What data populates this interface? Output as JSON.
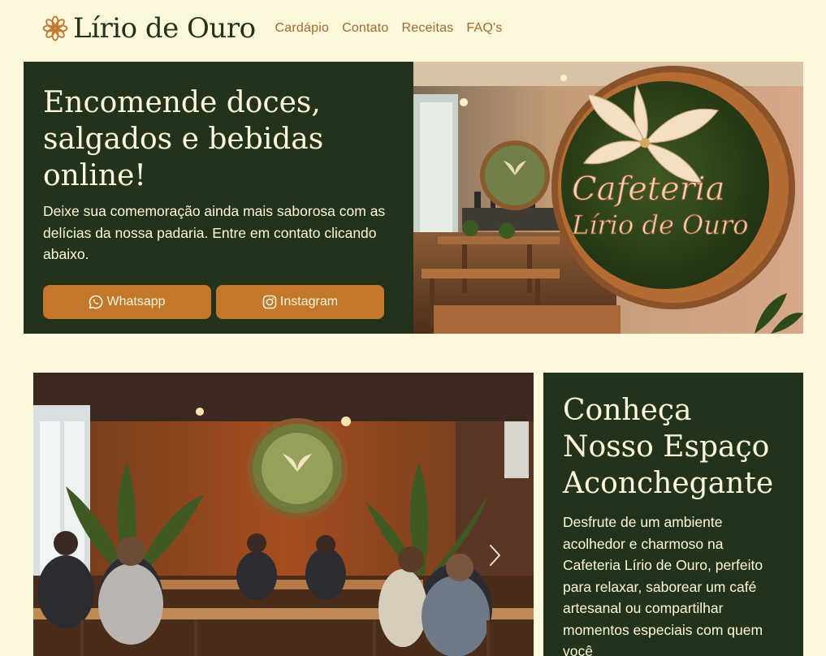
{
  "header": {
    "brand": "Lírio de Ouro",
    "nav": [
      "Cardápio",
      "Contato",
      "Receitas",
      "FAQ's"
    ]
  },
  "hero": {
    "title": "Encomende doces, salgados e bebidas online!",
    "description": "Deixe sua comemoração ainda mais saborosa com as delícias da nossa padaria. Entre em contato clicando abaixo.",
    "whatsapp_label": "Whatsapp",
    "instagram_label": "Instagram",
    "sign_line1": "Cafeteria",
    "sign_line2": "Lírio de Ouro"
  },
  "about": {
    "title": "Conheça Nosso Espaço Aconchegante",
    "description": "Desfrute de um ambiente acolhedor e charmoso na Cafeteria Lírio de Ouro, perfeito para relaxar, saborear um café artesanal ou compartilhar momentos especiais com quem você"
  },
  "colors": {
    "background": "#fdf7dc",
    "dark_green": "#23321a",
    "accent": "#c2772b",
    "nav_text": "#a3692e"
  },
  "icons": {
    "brand": "flower-icon",
    "whatsapp": "whatsapp-icon",
    "instagram": "instagram-icon",
    "carousel_next": "chevron-right-icon"
  }
}
